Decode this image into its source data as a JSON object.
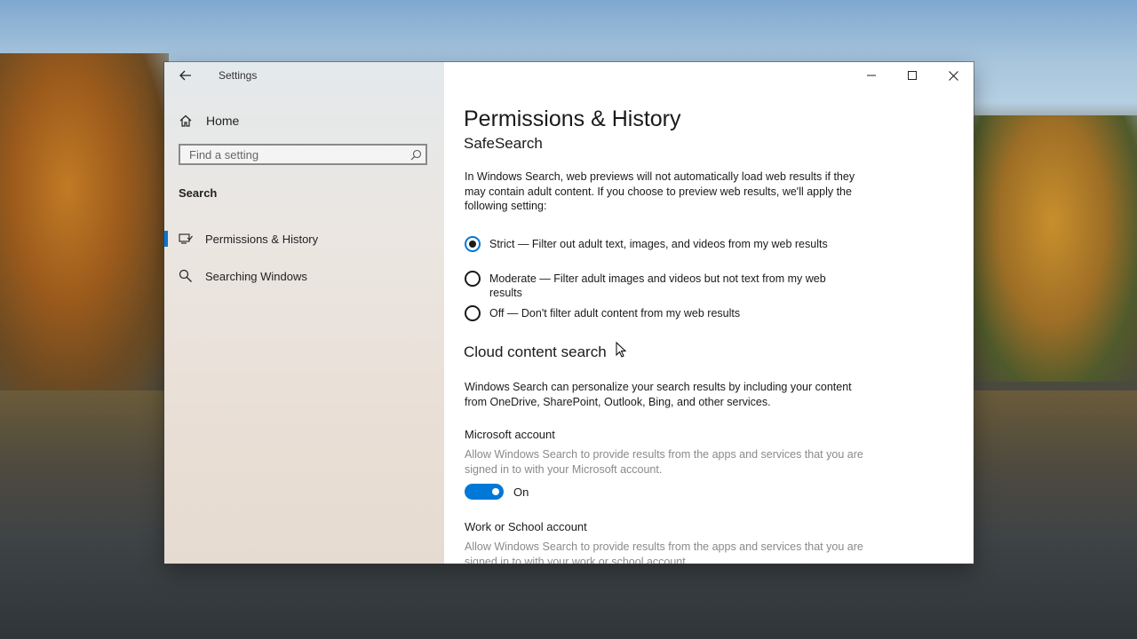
{
  "window": {
    "app_title": "Settings",
    "controls": [
      "minimize-icon",
      "maximize-icon",
      "close-icon"
    ]
  },
  "sidebar": {
    "home_label": "Home",
    "search_placeholder": "Find a setting",
    "section_label": "Search",
    "items": [
      {
        "label": "Permissions & History",
        "icon": "permissions-icon",
        "active": true
      },
      {
        "label": "Searching Windows",
        "icon": "search-icon",
        "active": false
      }
    ]
  },
  "main": {
    "title": "Permissions & History",
    "safesearch": {
      "heading": "SafeSearch",
      "description": "In Windows Search, web previews will not automatically load web results if they may contain adult content. If you choose to preview web results, we'll apply the following setting:",
      "options": [
        {
          "label": "Strict — Filter out adult text, images, and videos from my web results",
          "checked": true
        },
        {
          "label": "Moderate — Filter adult images and videos but not text from my web results",
          "checked": false
        },
        {
          "label": "Off — Don't filter adult content from my web results",
          "checked": false
        }
      ]
    },
    "cloud": {
      "heading": "Cloud content search",
      "description": "Windows Search can personalize your search results by including your content from OneDrive, SharePoint, Outlook, Bing, and other services.",
      "microsoft": {
        "title": "Microsoft account",
        "description": "Allow Windows Search to provide results from the apps and services that you are signed in to with your Microsoft account.",
        "toggle_state": "On"
      },
      "work": {
        "title": "Work or School account",
        "description": "Allow Windows Search to provide results from the apps and services that you are signed in to with your work or school account."
      }
    }
  },
  "colors": {
    "accent": "#0078d7",
    "dim_text": "#8a8a8a"
  }
}
